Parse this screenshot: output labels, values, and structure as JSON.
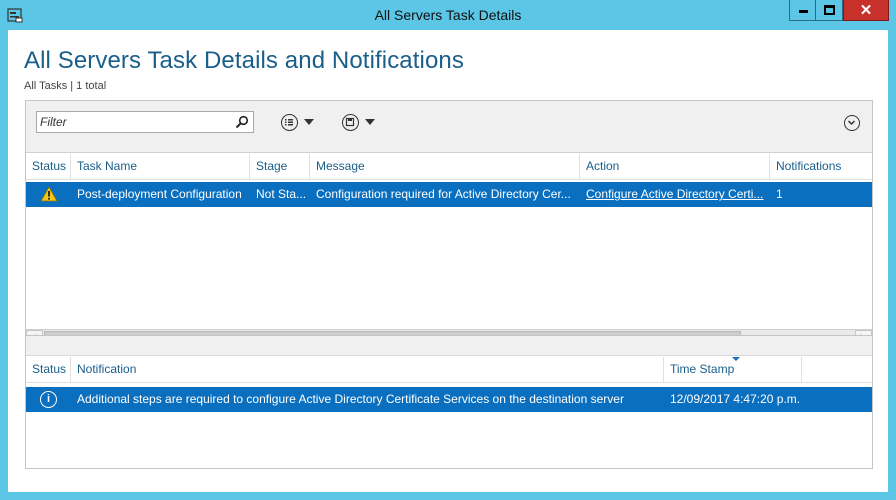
{
  "window": {
    "title": "All Servers Task Details",
    "minimize_glyph": "",
    "close_glyph": "✕",
    "accent_color": "#5bc6e6",
    "close_color": "#c7302b"
  },
  "page": {
    "title": "All Servers Task Details and Notifications",
    "subtitle": "All Tasks | 1 total"
  },
  "toolbar": {
    "filter_placeholder": "Filter",
    "search_icon": "search-icon",
    "list_dropdown_icon": "list-view-icon",
    "save_dropdown_icon": "save-icon",
    "collapse_icon": "chevron-down-icon"
  },
  "tasks": {
    "columns": [
      "Status",
      "Task Name",
      "Stage",
      "Message",
      "Action",
      "Notifications"
    ],
    "rows": [
      {
        "status_icon": "warning-icon",
        "task_name": "Post-deployment Configuration",
        "stage": "Not Sta...",
        "message": "Configuration required for Active Directory Cer...",
        "action": "Configure Active Directory Certi...",
        "notifications": "1"
      }
    ],
    "selection_color": "#0a6fbf"
  },
  "notifications": {
    "columns": [
      "Status",
      "Notification",
      "Time Stamp"
    ],
    "rows": [
      {
        "status_icon": "info-icon",
        "notification": "Additional steps are required to configure Active Directory Certificate Services on the destination server",
        "time_stamp": "12/09/2017 4:47:20 p.m."
      }
    ]
  }
}
